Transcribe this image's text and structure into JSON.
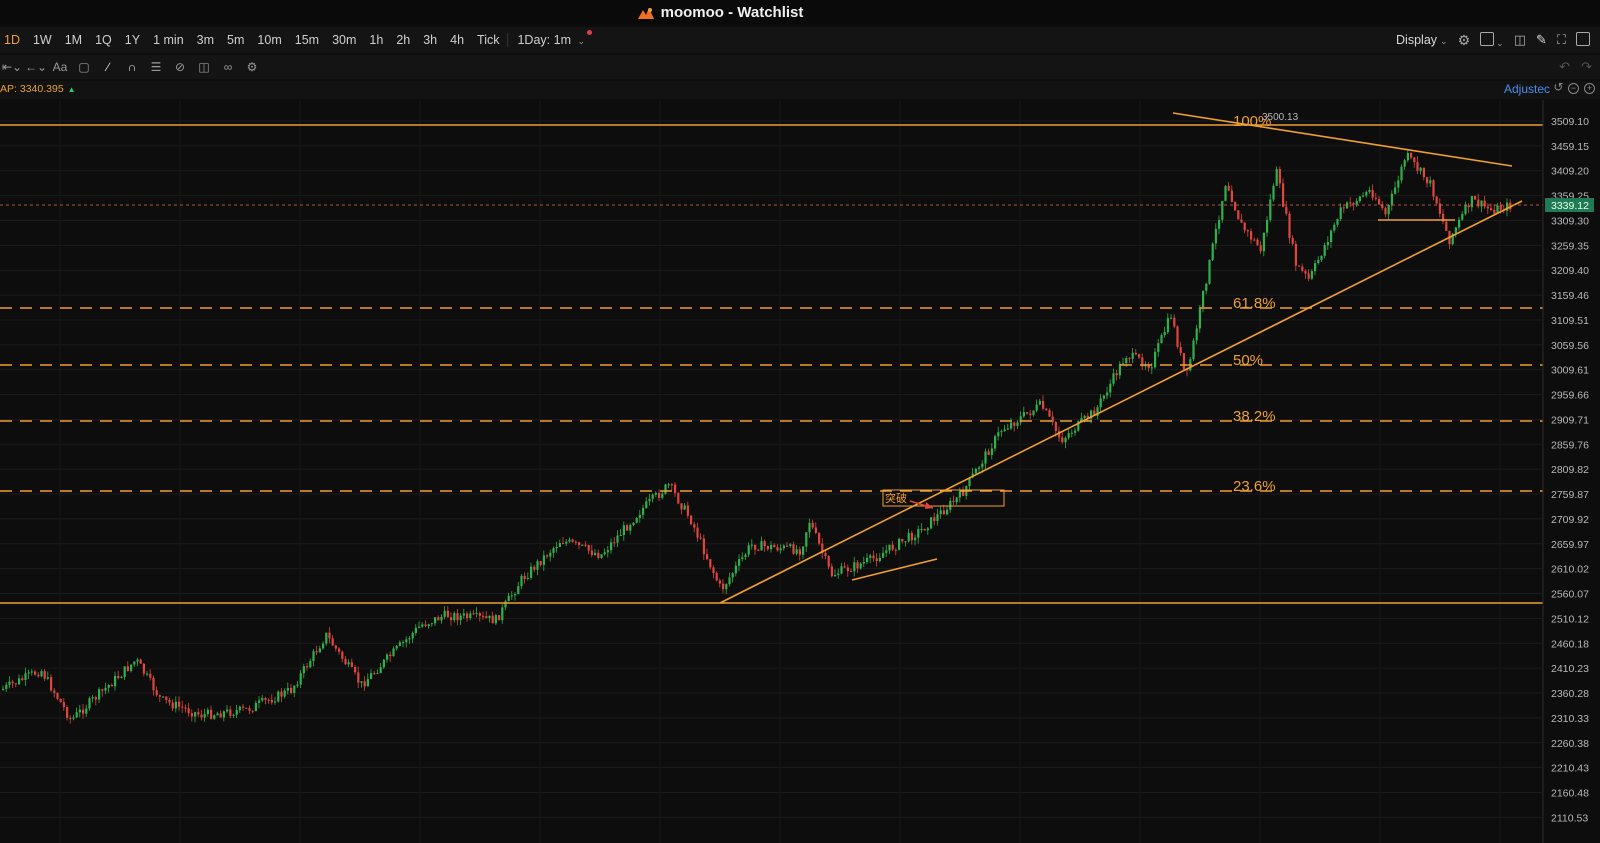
{
  "window": {
    "app": "moomoo",
    "title": "moomoo - Watchlist"
  },
  "timeframes": [
    "1D",
    "1W",
    "1M",
    "1Q",
    "1Y",
    "1 min",
    "3m",
    "5m",
    "10m",
    "15m",
    "30m",
    "1h",
    "2h",
    "3h",
    "4h",
    "Tick"
  ],
  "active_timeframe": "1D",
  "custom_timeframe": "1Day: 1m",
  "toolbar": {
    "display_label": "Display"
  },
  "drawing_tools": [
    "width-adjust-icon",
    "arrow-back-icon",
    "text-tool-icon",
    "comment-icon",
    "trend-line-icon",
    "magnet-icon",
    "layers-icon",
    "hide-icon",
    "trash-icon",
    "link-icon",
    "settings-icon"
  ],
  "indicator": {
    "vwap_label": "AP:",
    "vwap_value": "3340.395"
  },
  "adjusted_label": "Adjustec",
  "price_axis": {
    "labels": [
      "3509.10",
      "3459.15",
      "3409.20",
      "3359.25",
      "3309.30",
      "3259.35",
      "3209.40",
      "3159.46",
      "3109.51",
      "3059.56",
      "3009.61",
      "2959.66",
      "2909.71",
      "2859.76",
      "2809.82",
      "2759.87",
      "2709.92",
      "2659.97",
      "2610.02",
      "2560.07",
      "2510.12",
      "2460.18",
      "2410.23",
      "2360.28",
      "2310.33",
      "2260.38",
      "2210.43",
      "2160.48",
      "2110.53"
    ],
    "current_price": "3339.12"
  },
  "annotations": {
    "high_label": "3500.13",
    "fib_100": "100%",
    "fib_618": "61.8%",
    "fib_50": "50%",
    "fib_382": "38.2%",
    "fib_236": "23.6%",
    "breakout": "突破"
  },
  "colors": {
    "accent": "#f0a030",
    "candle_up": "#2fb24a",
    "candle_down": "#e0463c",
    "price_tag": "#1f7a55",
    "adjusted": "#4a8ff0"
  }
}
